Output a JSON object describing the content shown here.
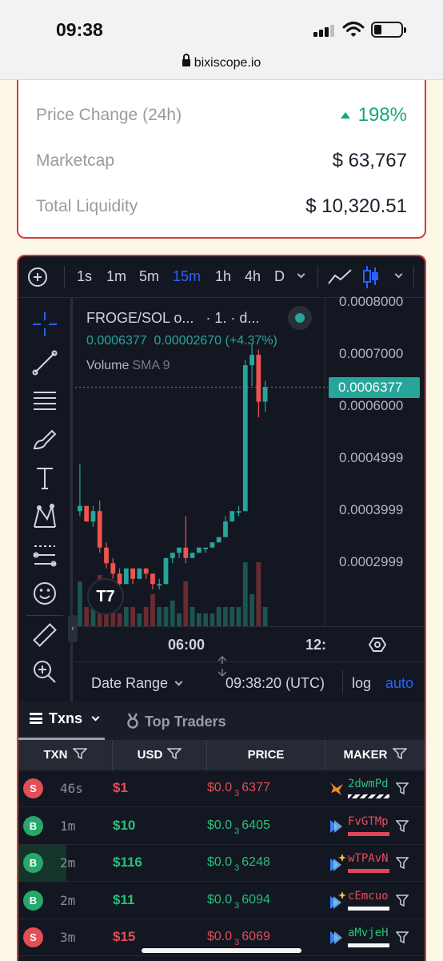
{
  "status_bar": {
    "time": "09:38",
    "url": "bixiscope.io"
  },
  "stats": [
    {
      "label": "Price Change (24h)",
      "value": "198%",
      "trend": "up"
    },
    {
      "label": "Marketcap",
      "value": "$ 63,767"
    },
    {
      "label": "Total Liquidity",
      "value": "$ 10,320.51"
    }
  ],
  "chart": {
    "toolbar": {
      "timeframes": [
        "1s",
        "1m",
        "5m",
        "15m",
        "1h",
        "4h",
        "D"
      ],
      "active": "15m"
    },
    "legend": {
      "symbol": "FROGE/SOL o...",
      "interval": "· 1. · d...",
      "price": "0.0006377",
      "change": "0.00002670",
      "change_pct": "(+4.37%)",
      "volume_label": "Volume",
      "sma_label": "SMA 9"
    },
    "current_price": "0.0006377",
    "x_ticks": [
      "06:00",
      "12:"
    ],
    "bottom": {
      "date_range": "Date Range",
      "time": "09:38:20 (UTC)",
      "log": "log",
      "auto": "auto"
    },
    "tv_logo": "T7"
  },
  "chart_data": {
    "type": "candlestick",
    "title": "FROGE/SOL",
    "y_ticks": [
      "0.0008000",
      "0.0007000",
      "0.0006000",
      "0.0004999",
      "0.0003999",
      "0.0002999"
    ],
    "y_tick_values": [
      0.0008,
      0.0007,
      0.0006,
      0.0004999,
      0.0003999,
      0.0002999
    ],
    "ylim": [
      0.000179,
      0.0008
    ],
    "x_ticks": [
      "06:00",
      "12:"
    ],
    "last_price": 0.0006377,
    "candles": [
      {
        "o": 0.0004,
        "h": 0.00049,
        "l": 0.00039,
        "c": 0.00041
      },
      {
        "o": 0.00041,
        "h": 0.00041,
        "l": 0.00038,
        "c": 0.00038
      },
      {
        "o": 0.00038,
        "h": 0.00041,
        "l": 0.00037,
        "c": 0.0004
      },
      {
        "o": 0.0004,
        "h": 0.00042,
        "l": 0.00032,
        "c": 0.00033
      },
      {
        "o": 0.00033,
        "h": 0.00034,
        "l": 0.00029,
        "c": 0.0003
      },
      {
        "o": 0.0003,
        "h": 0.00031,
        "l": 0.00027,
        "c": 0.00028
      },
      {
        "o": 0.00028,
        "h": 0.00029,
        "l": 0.00025,
        "c": 0.00026
      },
      {
        "o": 0.00026,
        "h": 0.00029,
        "l": 0.00026,
        "c": 0.00029
      },
      {
        "o": 0.00029,
        "h": 0.00029,
        "l": 0.00026,
        "c": 0.00027
      },
      {
        "o": 0.00027,
        "h": 0.00029,
        "l": 0.00027,
        "c": 0.00029
      },
      {
        "o": 0.00029,
        "h": 0.00029,
        "l": 0.00027,
        "c": 0.00028
      },
      {
        "o": 0.00028,
        "h": 0.00028,
        "l": 0.00025,
        "c": 0.00026
      },
      {
        "o": 0.00026,
        "h": 0.00027,
        "l": 0.00025,
        "c": 0.00026
      },
      {
        "o": 0.00026,
        "h": 0.00031,
        "l": 0.00026,
        "c": 0.00031
      },
      {
        "o": 0.00031,
        "h": 0.00032,
        "l": 0.0003,
        "c": 0.00032
      },
      {
        "o": 0.00032,
        "h": 0.00033,
        "l": 0.00031,
        "c": 0.00033
      },
      {
        "o": 0.00033,
        "h": 0.00039,
        "l": 0.0003,
        "c": 0.00031
      },
      {
        "o": 0.00031,
        "h": 0.00032,
        "l": 0.00031,
        "c": 0.00032
      },
      {
        "o": 0.00032,
        "h": 0.00033,
        "l": 0.00032,
        "c": 0.00033
      },
      {
        "o": 0.00033,
        "h": 0.00033,
        "l": 0.00032,
        "c": 0.00033
      },
      {
        "o": 0.00033,
        "h": 0.00034,
        "l": 0.00033,
        "c": 0.00034
      },
      {
        "o": 0.00034,
        "h": 0.00035,
        "l": 0.00034,
        "c": 0.00035
      },
      {
        "o": 0.00035,
        "h": 0.00039,
        "l": 0.00035,
        "c": 0.00038
      },
      {
        "o": 0.00038,
        "h": 0.0004,
        "l": 0.00038,
        "c": 0.0004
      },
      {
        "o": 0.0004,
        "h": 0.00041,
        "l": 0.00039,
        "c": 0.0004
      },
      {
        "o": 0.0004,
        "h": 0.00069,
        "l": 0.0004,
        "c": 0.00068
      },
      {
        "o": 0.00068,
        "h": 0.00072,
        "l": 0.00064,
        "c": 0.0007
      },
      {
        "o": 0.0007,
        "h": 0.00071,
        "l": 0.00058,
        "c": 0.00061
      },
      {
        "o": 0.00061,
        "h": 0.00065,
        "l": 0.00059,
        "c": 0.000638
      }
    ],
    "volume": [
      0.7,
      0.3,
      0.5,
      0.8,
      0.4,
      0.5,
      0.2,
      0.3,
      0.3,
      0.2,
      0.3,
      0.5,
      0.3,
      0.3,
      0.4,
      0.2,
      0.7,
      0.3,
      0.2,
      0.2,
      0.2,
      0.3,
      0.3,
      0.3,
      0.3,
      1.0,
      0.5,
      1.0,
      0.3
    ],
    "show_price_line": true
  },
  "txns": {
    "tabs": [
      "Txns",
      "Top Traders"
    ],
    "headers": [
      "TXN",
      "USD",
      "PRICE",
      "MAKER"
    ],
    "rows": [
      {
        "type": "S",
        "age": "46s",
        "usd": "$1",
        "price_prefix": "$0.0",
        "price_sub": "3",
        "price_tail": "6377",
        "maker": "2dwmPd"
      },
      {
        "type": "B",
        "age": "1m",
        "usd": "$10",
        "price_prefix": "$0.0",
        "price_sub": "3",
        "price_tail": "6405",
        "maker": "FvGTMp"
      },
      {
        "type": "B",
        "age": "2m",
        "usd": "$116",
        "price_prefix": "$0.0",
        "price_sub": "3",
        "price_tail": "6248",
        "maker": "wTPAvN"
      },
      {
        "type": "B",
        "age": "2m",
        "usd": "$11",
        "price_prefix": "$0.0",
        "price_sub": "3",
        "price_tail": "6094",
        "maker": "cEmcuo"
      },
      {
        "type": "S",
        "age": "3m",
        "usd": "$15",
        "price_prefix": "$0.0",
        "price_sub": "3",
        "price_tail": "6069",
        "maker": "aMvjeH"
      }
    ]
  },
  "colors": {
    "accent": "#2962ff",
    "up": "#26a69a",
    "down": "#ef5350",
    "card_border": "#d83a3a"
  }
}
